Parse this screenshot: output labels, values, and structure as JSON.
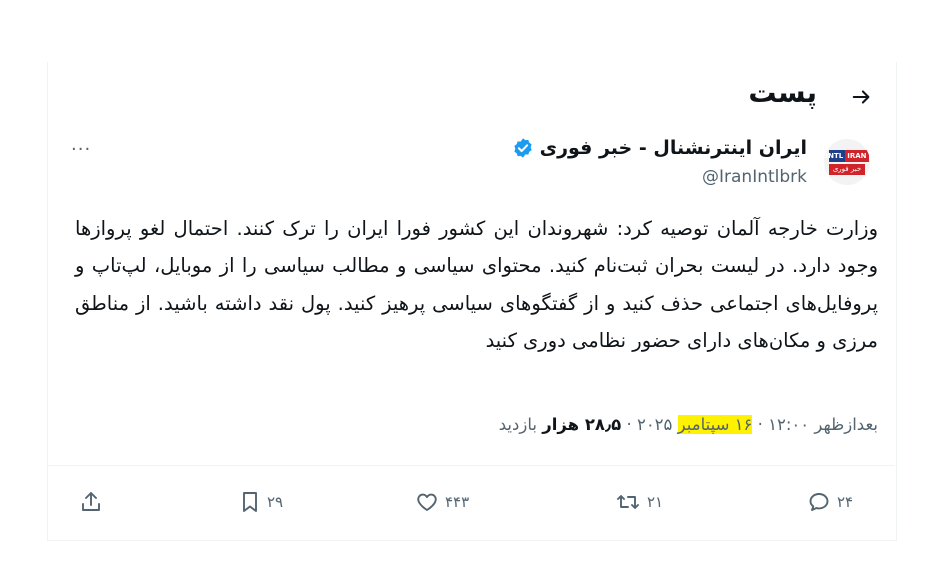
{
  "header": {
    "title": "پست",
    "back_icon": "arrow-right-icon"
  },
  "author": {
    "name": "ایران اینترنشنال - خبر فوری",
    "handle": "@IranIntlbrk",
    "avatar_line1_a": "INTL",
    "avatar_line1_b": "IRAN",
    "avatar_line2": "خبر فوری",
    "verified_color": "#1d9bf0",
    "more_label": "···"
  },
  "post": {
    "text": "وزارت خارجه آلمان توصیه کرد: شهروندان این کشور فورا ایران را ترک کنند. احتمال لغو پروازها وجود دارد. در لیست بحران ثبت‌نام کنید. محتوای سیاسی و مطالب سیاسی را از موبایل، لپ‌تاپ و پروفایل‌های اجتماعی حذف کنید و از گفتگوهای سیاسی پرهیز کنید. پول نقد داشته باشید. از مناطق مرزی و مکان‌های دارای حضور نظامی دوری کنید"
  },
  "meta": {
    "time": "بعدازظهر ۱۲:۰۰",
    "sep": " · ",
    "date": "۱۶ سپتامبر",
    "year": " ۲۰۲۵",
    "views": "۲۸٫۵ هزار",
    "views_label": " بازدید",
    "highlight_color": "#fff200"
  },
  "actions": {
    "reply_count": "۲۴",
    "repost_count": "۲۱",
    "like_count": "۴۴۳",
    "bookmark_count": "۲۹"
  }
}
